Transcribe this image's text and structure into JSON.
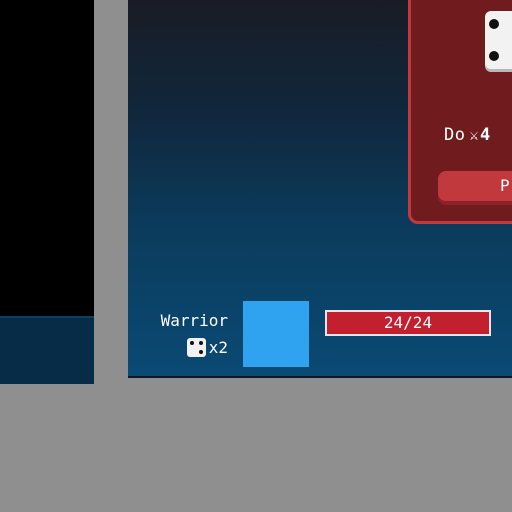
{
  "card": {
    "action_prefix": "Do",
    "sword_icon": "⚔",
    "damage": "4",
    "button_label": "P",
    "color": "#701c1e",
    "border_color": "#c2393d"
  },
  "player": {
    "name": "Warrior",
    "dice_count": "x2",
    "portrait_color": "#2fa3f0",
    "hp_text": "24/24",
    "hp_current": 24,
    "hp_max": 24,
    "hp_color": "#c2202f"
  }
}
